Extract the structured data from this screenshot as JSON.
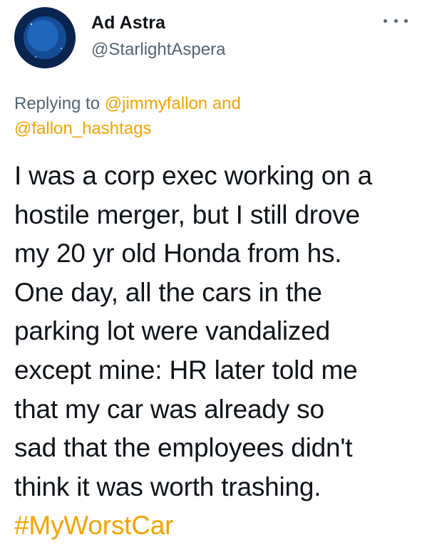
{
  "tweet": {
    "author_name": "Ad Astra",
    "author_handle": "@StarlightAspera",
    "avatar_icon": "crescent-moon-avatar",
    "more_icon": "more-dots-icon",
    "reply": {
      "prefix": "Replying to ",
      "mention1": "@jimmyfallon",
      "joiner": " and",
      "mention2": "@fallon_hashtags"
    },
    "body_lines": [
      "I was a corp exec working on a",
      "hostile merger, but I still drove",
      "my 20 yr old Honda from hs.",
      "One day, all the cars in the",
      "parking lot were vandalized",
      "except mine: HR later told me",
      "that my car was already so",
      "sad that the employees didn't",
      "think it was worth trashing."
    ],
    "hashtag": "#MyWorstCar"
  },
  "colors": {
    "text": "#0f1419",
    "secondary": "#536471",
    "accent": "#f4a300",
    "avatar_bg": "#0b2a5c"
  }
}
